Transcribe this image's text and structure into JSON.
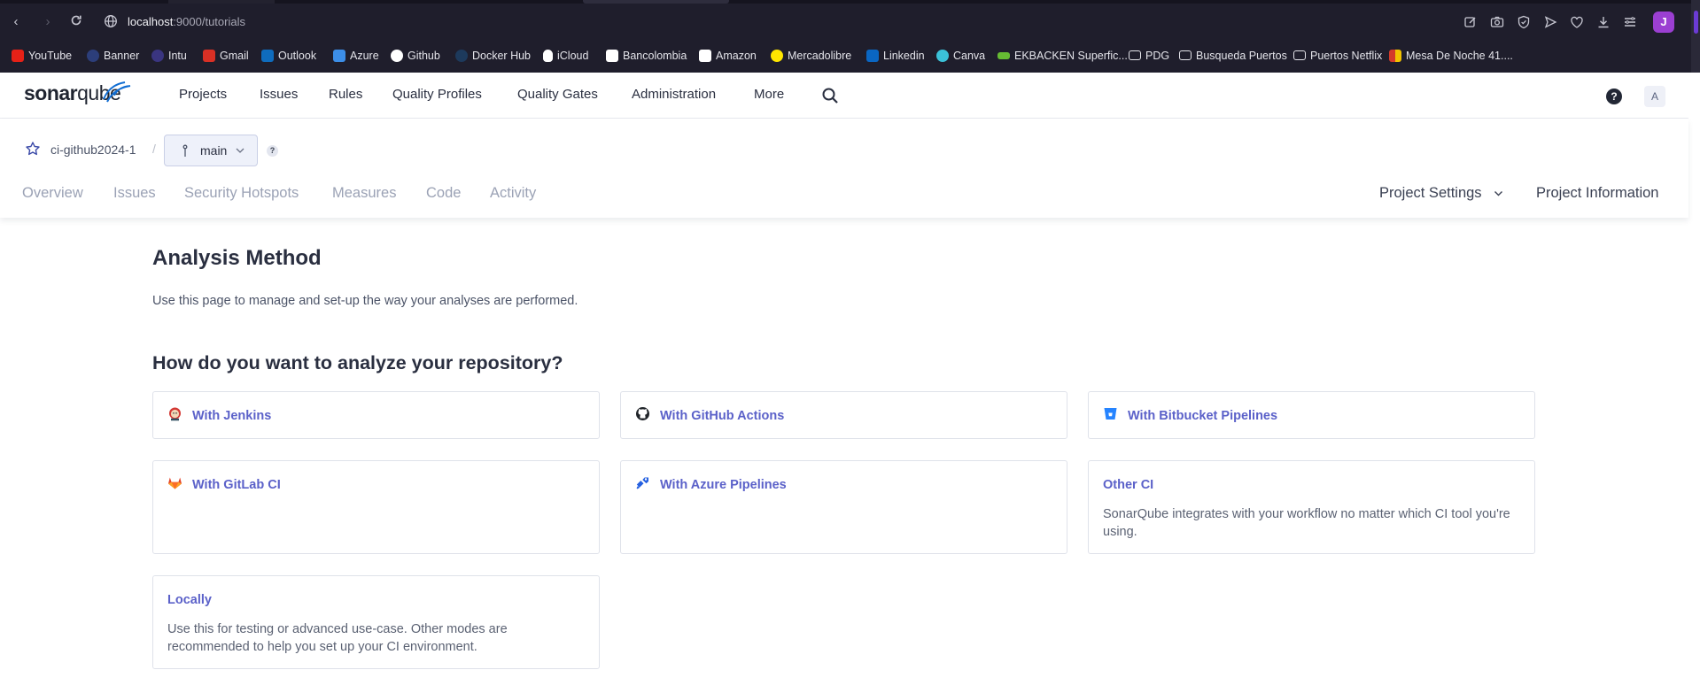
{
  "browser": {
    "url_host": "localhost",
    "url_path": ":9000/tutorials",
    "profile_initial": "J",
    "bookmarks": [
      {
        "label": "YouTube",
        "icon": "youtube-icon",
        "color": "#e62117"
      },
      {
        "label": "Banner",
        "icon": "banner-icon",
        "color": "#2c3e7a"
      },
      {
        "label": "Intu",
        "icon": "intu-icon",
        "color": "#3a3580"
      },
      {
        "label": "Gmail",
        "icon": "gmail-icon",
        "color": "#d93025"
      },
      {
        "label": "Outlook",
        "icon": "outlook-icon",
        "color": "#0f6cbd"
      },
      {
        "label": "Azure",
        "icon": "azure-icon",
        "color": "#3c8ee8"
      },
      {
        "label": "Github",
        "icon": "github-icon",
        "color": "#ffffff"
      },
      {
        "label": "Docker Hub",
        "icon": "docker-icon",
        "color": "#1d3a5c"
      },
      {
        "label": "iCloud",
        "icon": "apple-icon",
        "color": "#ffffff"
      },
      {
        "label": "Bancolombia",
        "icon": "bancolombia-icon",
        "color": "#ffffff"
      },
      {
        "label": "Amazon",
        "icon": "amazon-icon",
        "color": "#ffffff"
      },
      {
        "label": "Mercadolibre",
        "icon": "mercadolibre-icon",
        "color": "#ffe600"
      },
      {
        "label": "Linkedin",
        "icon": "linkedin-icon",
        "color": "#0a66c2"
      },
      {
        "label": "Canva",
        "icon": "canva-icon",
        "color": "#3bc1d8"
      },
      {
        "label": "EKBACKEN Superfic...",
        "icon": "ekbacken-icon",
        "color": "#66bb33"
      },
      {
        "label": "PDG",
        "icon": "folder-icon",
        "color": "#e4e4ea"
      },
      {
        "label": "Busqueda Puertos",
        "icon": "folder-icon",
        "color": "#e4e4ea"
      },
      {
        "label": "Puertos Netflix",
        "icon": "folder-icon",
        "color": "#e4e4ea"
      },
      {
        "label": "Mesa De Noche 41....",
        "icon": "mesa-icon",
        "color": "#d43a2a"
      }
    ]
  },
  "header": {
    "logo_left": "sonar",
    "logo_right": "qube",
    "nav": [
      "Projects",
      "Issues",
      "Rules",
      "Quality Profiles",
      "Quality Gates",
      "Administration",
      "More"
    ],
    "avatar_initial": "A",
    "help_symbol": "?"
  },
  "project": {
    "name": "ci-github2024-1",
    "separator": "/",
    "branch": "main",
    "branch_help": "?",
    "tabs": [
      "Overview",
      "Issues",
      "Security Hotspots",
      "Measures",
      "Code",
      "Activity"
    ],
    "settings_label": "Project Settings",
    "info_label": "Project Information"
  },
  "content": {
    "title": "Analysis Method",
    "description": "Use this page to manage and set-up the way your analyses are performed.",
    "question": "How do you want to analyze your repository?",
    "options": [
      {
        "label": "With Jenkins",
        "icon": "jenkins-icon"
      },
      {
        "label": "With GitHub Actions",
        "icon": "github-icon"
      },
      {
        "label": "With Bitbucket Pipelines",
        "icon": "bitbucket-icon"
      },
      {
        "label": "With GitLab CI",
        "icon": "gitlab-icon"
      },
      {
        "label": "With Azure Pipelines",
        "icon": "azure-pipelines-icon"
      },
      {
        "label": "Other CI",
        "description": "SonarQube integrates with your workflow no matter which CI tool you're using."
      },
      {
        "label": "Locally",
        "description": "Use this for testing or advanced use-case. Other modes are recommended to help you set up your CI environment."
      }
    ]
  },
  "colors": {
    "accent": "#5b61c9",
    "browser_bg": "#1f1e2c",
    "text": "#2a2f40",
    "muted_tab": "#9ba2b5"
  }
}
